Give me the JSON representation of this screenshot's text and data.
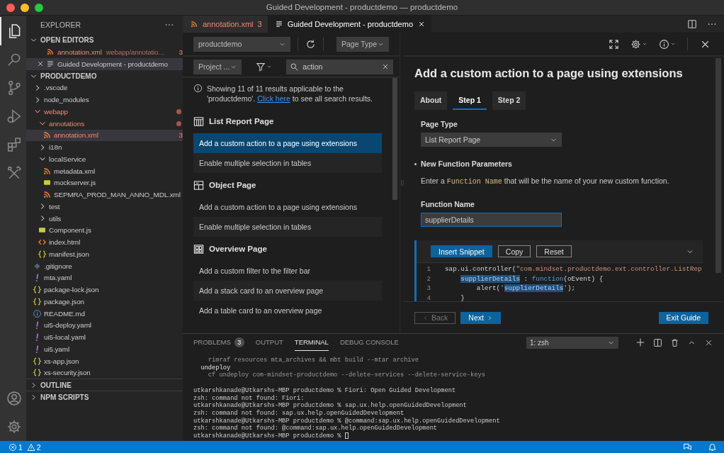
{
  "window": {
    "title": "Guided Development - productdemo — productdemo"
  },
  "activity_bar": {
    "items": [
      {
        "kind": "explorer",
        "selected": true
      },
      {
        "kind": "search",
        "selected": false
      },
      {
        "kind": "source-control",
        "selected": false
      },
      {
        "kind": "run",
        "selected": false
      },
      {
        "kind": "extensions",
        "selected": false
      },
      {
        "kind": "tools",
        "selected": false
      }
    ]
  },
  "explorer": {
    "title": "EXPLORER",
    "sections": [
      {
        "title": "OPEN EDITORS",
        "kind": "open-editors",
        "expanded": true,
        "items": [
          {
            "name": "annotation.xml",
            "path": "webapp/annotatio…",
            "badge": "3",
            "kind": "xml",
            "error": true,
            "selected": false
          },
          {
            "name": "Guided Development - productdemo",
            "kind": "doc",
            "error": false,
            "selected": true
          }
        ]
      },
      {
        "title": "PRODUCTDEMO",
        "kind": "tree",
        "expanded": true,
        "items": [
          {
            "name": ".vscode",
            "kind": "folder",
            "expanded": false,
            "error": false,
            "selected": false
          },
          {
            "name": "node_modules",
            "kind": "folder",
            "expanded": false,
            "error": false,
            "selected": false
          },
          {
            "name": "webapp",
            "kind": "folder",
            "expanded": true,
            "error": true,
            "selected": false,
            "children": [
              {
                "name": "annotations",
                "kind": "folder",
                "expanded": true,
                "error": true,
                "selected": false,
                "children": [
                  {
                    "name": "annotation.xml",
                    "kind": "xml",
                    "badge": "3",
                    "error": true,
                    "selected": true
                  }
                ]
              },
              {
                "name": "i18n",
                "kind": "folder",
                "expanded": false,
                "error": false,
                "selected": false
              },
              {
                "name": "localService",
                "kind": "folder",
                "expanded": true,
                "error": false,
                "selected": false,
                "children": [
                  {
                    "name": "metadata.xml",
                    "kind": "xml",
                    "error": false,
                    "selected": false
                  },
                  {
                    "name": "mockserver.js",
                    "kind": "js",
                    "error": false,
                    "selected": false
                  },
                  {
                    "name": "SEPMRA_PROD_MAN_ANNO_MDL.xml",
                    "kind": "xml",
                    "error": false,
                    "selected": false
                  }
                ]
              },
              {
                "name": "test",
                "kind": "folder",
                "expanded": false,
                "error": false,
                "selected": false
              },
              {
                "name": "utils",
                "kind": "folder",
                "expanded": false,
                "error": false,
                "selected": false
              },
              {
                "name": "Component.js",
                "kind": "js",
                "error": false,
                "selected": false
              },
              {
                "name": "index.html",
                "kind": "html",
                "error": false,
                "selected": false
              },
              {
                "name": "manifest.json",
                "kind": "json",
                "error": false,
                "selected": false
              }
            ]
          },
          {
            "name": ".gitignore",
            "kind": "git",
            "error": false,
            "selected": false
          },
          {
            "name": "mta.yaml",
            "kind": "yaml",
            "error": false,
            "selected": false
          },
          {
            "name": "package-lock.json",
            "kind": "json",
            "error": false,
            "selected": false
          },
          {
            "name": "package.json",
            "kind": "json",
            "error": false,
            "selected": false
          },
          {
            "name": "README.md",
            "kind": "info",
            "error": false,
            "selected": false
          },
          {
            "name": "ui5-deploy.yaml",
            "kind": "yaml",
            "error": false,
            "selected": false
          },
          {
            "name": "ui5-local.yaml",
            "kind": "yaml",
            "error": false,
            "selected": false
          },
          {
            "name": "ui5.yaml",
            "kind": "yaml",
            "error": false,
            "selected": false
          },
          {
            "name": "xs-app.json",
            "kind": "json",
            "error": false,
            "selected": false
          },
          {
            "name": "xs-security.json",
            "kind": "json",
            "error": false,
            "selected": false
          }
        ]
      },
      {
        "title": "OUTLINE",
        "kind": "collapsed",
        "expanded": false
      },
      {
        "title": "NPM SCRIPTS",
        "kind": "collapsed",
        "expanded": false
      }
    ]
  },
  "editor_tabs": [
    {
      "label": "annotation.xml",
      "badge": "3",
      "kind": "xml",
      "error": true,
      "selected": false
    },
    {
      "label": "Guided Development - productdemo",
      "kind": "doc",
      "error": false,
      "selected": true
    }
  ],
  "guide_list": {
    "project_select": "productdemo",
    "page_type_select": "Page Type",
    "scope_select": "Project ...",
    "search": {
      "value": "action"
    },
    "info": {
      "before": "Showing 11 of 11 results applicable to the 'productdemo'.",
      "link": "Click here",
      "after": "to see all search results."
    },
    "groups": [
      {
        "title": "List Report Page",
        "kind": "list-report",
        "items": [
          {
            "label": "Add a custom action to a page using extensions",
            "selected": true
          },
          {
            "label": "Enable multiple selection in tables",
            "selected": false
          }
        ]
      },
      {
        "title": "Object Page",
        "kind": "object",
        "items": [
          {
            "label": "Add a custom action to a page using extensions",
            "selected": false
          },
          {
            "label": "Enable multiple selection in tables",
            "selected": false
          }
        ]
      },
      {
        "title": "Overview Page",
        "kind": "overview",
        "items": [
          {
            "label": "Add a custom filter to the filter bar",
            "selected": false
          },
          {
            "label": "Add a stack card to an overview page",
            "selected": false
          },
          {
            "label": "Add a table card to an overview page",
            "selected": false
          }
        ]
      }
    ]
  },
  "guide": {
    "title": "Add a custom action to a page using extensions",
    "tabs": [
      {
        "label": "About",
        "selected": false
      },
      {
        "label": "Step 1",
        "selected": true
      },
      {
        "label": "Step 2",
        "selected": false
      }
    ],
    "page_type": {
      "label": "Page Type",
      "value": "List Report Page"
    },
    "section_title": "New Function Parameters",
    "instruction": {
      "before": "Enter a",
      "code": "Function Name",
      "after": "that will be the name of your new custom function."
    },
    "function_name": {
      "label": "Function Name",
      "value": "supplierDetails"
    },
    "snippet": {
      "buttons": [
        {
          "label": "Insert Snippet",
          "kind": "primary"
        },
        {
          "label": "Copy",
          "kind": "outline"
        },
        {
          "label": "Reset",
          "kind": "outline"
        }
      ],
      "lines": [
        {
          "number": "1",
          "tokens": [
            {
              "text": "sap.ui.controller(",
              "kind": "plain"
            },
            {
              "text": "\"com.mindset.productdemo.ext.controller.ListRep",
              "kind": "string"
            }
          ]
        },
        {
          "number": "2",
          "tokens": [
            {
              "text": "    supplierDetails",
              "kind": "match"
            },
            {
              "text": " : ",
              "kind": "plain"
            },
            {
              "text": "function",
              "kind": "keyword"
            },
            {
              "text": "(oEvent) {",
              "kind": "plain"
            }
          ]
        },
        {
          "number": "3",
          "tokens": [
            {
              "text": "        alert(",
              "kind": "plain"
            },
            {
              "text": "'",
              "kind": "string"
            },
            {
              "text": "supplierDetails",
              "kind": "match"
            },
            {
              "text": "'",
              "kind": "string"
            },
            {
              "text": ");",
              "kind": "plain"
            }
          ]
        },
        {
          "number": "4",
          "tokens": [
            {
              "text": "    }",
              "kind": "plain"
            }
          ]
        }
      ]
    },
    "back": {
      "label": "Back",
      "disabled": true
    },
    "next": {
      "label": "Next",
      "disabled": false
    },
    "exit": "Exit Guide"
  },
  "panel": {
    "tabs": [
      {
        "label": "PROBLEMS",
        "badge": "3",
        "selected": false
      },
      {
        "label": "OUTPUT",
        "selected": false
      },
      {
        "label": "TERMINAL",
        "selected": true
      },
      {
        "label": "DEBUG CONSOLE",
        "selected": false
      }
    ],
    "terminal_select": "1: zsh",
    "cursor": true,
    "blocks": [
      [
        {
          "text": "    rimraf resources mta_archives && mbt build --mtar archive",
          "kind": "dim"
        },
        {
          "text": "  undeploy",
          "kind": "bright"
        },
        {
          "text": "    cf undeploy com-mindset-productdemo --delete-services --delete-service-keys",
          "kind": "dim"
        }
      ],
      [
        {
          "text": "utkarshkanade@Utkarshs-MBP productdemo % Fiori: Open Guided Development",
          "kind": "plain"
        },
        {
          "text": "zsh: command not found: Fiori:",
          "kind": "plain"
        },
        {
          "text": "utkarshkanade@Utkarshs-MBP productdemo % sap.ux.help.openGuidedDevelopment",
          "kind": "plain"
        },
        {
          "text": "zsh: command not found: sap.ux.help.openGuidedDevelopment",
          "kind": "plain"
        },
        {
          "text": "utkarshkanade@Utkarshs-MBP productdemo % @command:sap.ux.help.openGuidedDevelopment",
          "kind": "plain"
        },
        {
          "text": "zsh: command not found: @command:sap.ux.help.openGuidedDevelopment",
          "kind": "plain"
        },
        {
          "text": "utkarshkanade@Utkarshs-MBP productdemo %",
          "kind": "plain"
        }
      ]
    ]
  },
  "status_bar": {
    "errors": "1",
    "warnings": "2"
  }
}
